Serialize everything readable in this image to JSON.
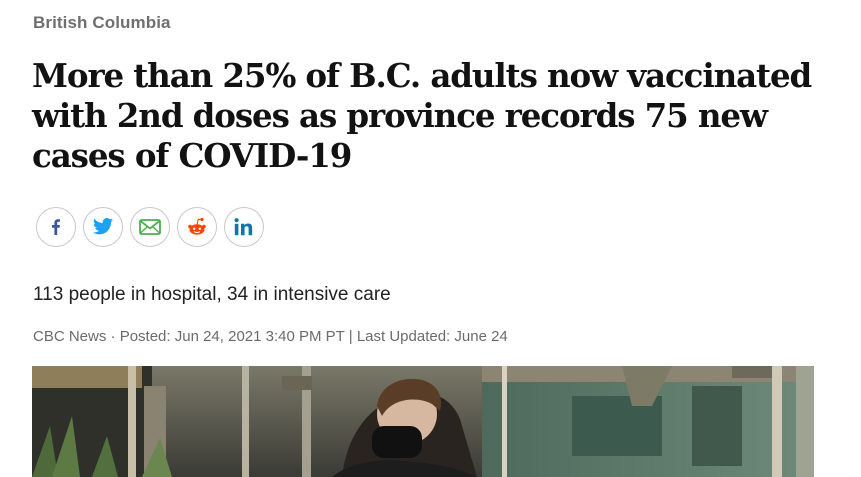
{
  "section": {
    "label": "British Columbia"
  },
  "article": {
    "headline": "More than 25% of B.C. adults now vaccinated with 2nd doses as province records 75 new cases of COVID-19",
    "deck": "113 people in hospital, 34 in intensive care",
    "byline": {
      "source": "CBC News",
      "separator_dot": " · ",
      "posted": "Posted: Jun 24, 2021 3:40 PM PT",
      "separator_bar": " | ",
      "updated": "Last Updated: June 24"
    }
  },
  "share": {
    "buttons": [
      {
        "icon": "facebook-icon",
        "color": "#3b5998"
      },
      {
        "icon": "twitter-icon",
        "color": "#1da1f2"
      },
      {
        "icon": "email-icon",
        "color": "#4caf50"
      },
      {
        "icon": "reddit-icon",
        "color": "#ff4500"
      },
      {
        "icon": "linkedin-icon",
        "color": "#0e76a8"
      }
    ]
  }
}
